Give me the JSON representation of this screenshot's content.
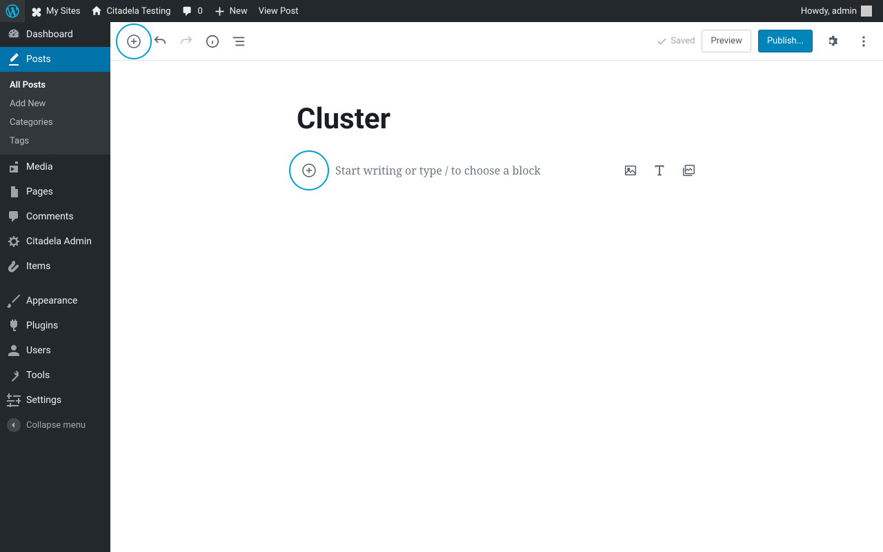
{
  "adminbar": {
    "my_sites": "My Sites",
    "site_name": "Citadela Testing",
    "comments_count": "0",
    "new": "New",
    "view_post": "View Post",
    "howdy": "Howdy, admin"
  },
  "sidebar": {
    "dashboard": "Dashboard",
    "posts": "Posts",
    "posts_sub": {
      "all": "All Posts",
      "add_new": "Add New",
      "categories": "Categories",
      "tags": "Tags"
    },
    "media": "Media",
    "pages": "Pages",
    "comments": "Comments",
    "citadela": "Citadela Admin",
    "items": "Items",
    "appearance": "Appearance",
    "plugins": "Plugins",
    "users": "Users",
    "tools": "Tools",
    "settings": "Settings",
    "collapse": "Collapse menu"
  },
  "toolbar": {
    "saved": "Saved",
    "preview": "Preview",
    "publish": "Publish..."
  },
  "editor": {
    "title": "Cluster",
    "placeholder": "Start writing or type / to choose a block"
  }
}
